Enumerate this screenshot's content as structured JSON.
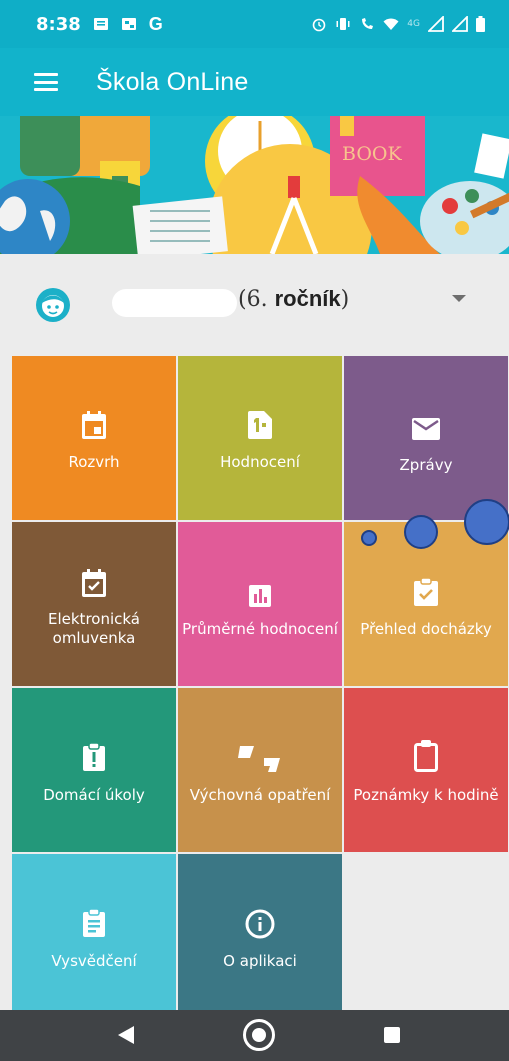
{
  "status_bar": {
    "time": "8:38",
    "left_icons": [
      "message-icon",
      "sim-icon",
      "google-icon"
    ],
    "google_letter": "G",
    "right_icons": [
      "alarm-icon",
      "vibrate-icon",
      "wifi-calling-icon",
      "wifi-icon",
      "signal-icon",
      "signal-icon",
      "battery-icon"
    ],
    "network_label": "4G"
  },
  "app_bar": {
    "title": "Škola OnLine",
    "menu_icon": "hamburger-menu-icon"
  },
  "banner": {
    "book_text": "BOOK"
  },
  "student": {
    "grade_open": "(6. ",
    "grade_bold": "ročník",
    "grade_close": ")"
  },
  "tiles": [
    {
      "label": "Rozvrh",
      "icon": "calendar-icon",
      "color": "#ef8a22"
    },
    {
      "label": "Hodnocení",
      "icon": "grade-one-icon",
      "color": "#b5b53b"
    },
    {
      "label": "Zprávy",
      "icon": "envelope-icon",
      "color": "#7d5b8b"
    },
    {
      "label": "Elektronická omluvenka",
      "icon": "calendar-check-icon",
      "color": "#7f5937"
    },
    {
      "label": "Průměrné hodnocení",
      "icon": "bar-chart-icon",
      "color": "#e15b98"
    },
    {
      "label": "Přehled docházky",
      "icon": "clipboard-check-icon",
      "color": "#e1a84e"
    },
    {
      "label": "Domácí úkoly",
      "icon": "clipboard-alert-icon",
      "color": "#23987a"
    },
    {
      "label": "Výchovná opatření",
      "icon": "quote-icon",
      "color": "#c7914b"
    },
    {
      "label": "Poznámky k hodině",
      "icon": "clipboard-outline-icon",
      "color": "#dd4f4f"
    },
    {
      "label": "Vysvědčení",
      "icon": "clipboard-text-icon",
      "color": "#4bc4d6"
    },
    {
      "label": "O aplikaci",
      "icon": "info-icon",
      "color": "#3b7785"
    }
  ],
  "nav_bar": {
    "back": "back-icon",
    "home": "home-icon",
    "recents": "recents-icon"
  }
}
